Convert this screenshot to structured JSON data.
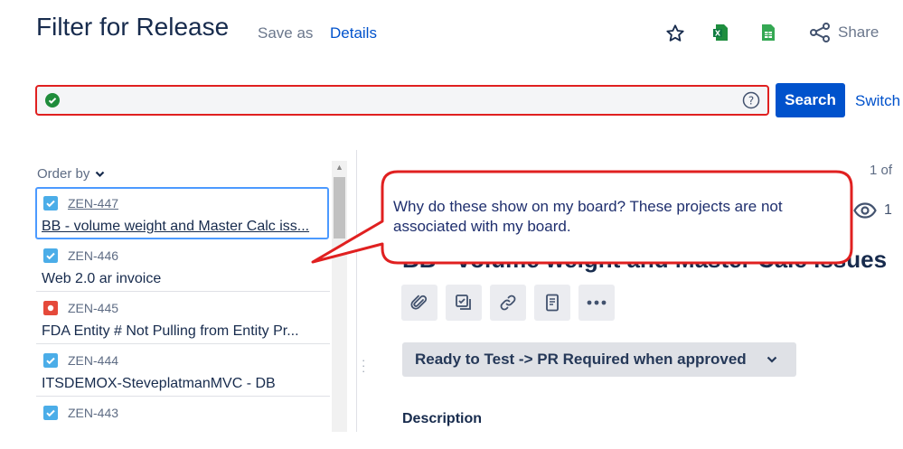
{
  "header": {
    "title": "Filter for Release",
    "save_as": "Save as",
    "details": "Details",
    "share": "Share"
  },
  "search": {
    "value": "",
    "button": "Search",
    "switch": "Switch"
  },
  "list": {
    "order_by": "Order by",
    "items": [
      {
        "key": "ZEN-447",
        "summary": "BB - volume weight and Master Calc iss...",
        "type": "task"
      },
      {
        "key": "ZEN-446",
        "summary": "Web 2.0 ar invoice",
        "type": "task"
      },
      {
        "key": "ZEN-445",
        "summary": "FDA Entity # Not Pulling from Entity Pr...",
        "type": "bug"
      },
      {
        "key": "ZEN-444",
        "summary": "ITSDEMOX-SteveplatmanMVC - DB",
        "type": "task"
      },
      {
        "key": "ZEN-443",
        "summary": "",
        "type": "task"
      }
    ]
  },
  "detail": {
    "count": "1 of",
    "watchers": "1",
    "title": "BB - volume weight and Master Calc issues",
    "status": "Ready to Test -> PR Required when approved",
    "description_label": "Description"
  },
  "callout": {
    "text": "Why do these show on my board? These projects are not associated with my board."
  },
  "colors": {
    "primary": "#0052cc",
    "callout_border": "#e02020",
    "task_icon": "#4bade8",
    "bug_icon": "#e5493a"
  }
}
